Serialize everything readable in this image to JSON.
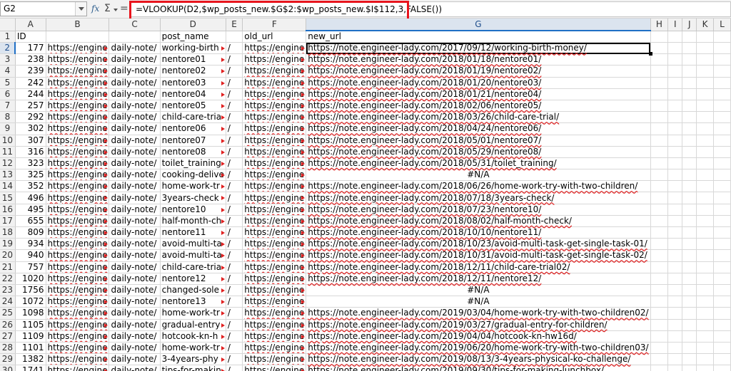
{
  "formula_bar": {
    "cell_ref": "G2",
    "fx_label": "fx",
    "sum_label": "Σ",
    "equals_label": "=",
    "formula": "=VLOOKUP(D2,$wp_posts_new.$G$2:$wp_posts_new.$I$112,3,FALSE())"
  },
  "highlight_color": "#e8141d",
  "columns": [
    "A",
    "B",
    "C",
    "D",
    "E",
    "F",
    "G",
    "H",
    "I",
    "J",
    "K",
    "L"
  ],
  "active_column": "G",
  "active_row": "2",
  "rows": [
    {
      "n": "1",
      "a": "ID",
      "b": "",
      "c": "",
      "d": "post_name",
      "e": "",
      "f": "old_url",
      "g": "new_url"
    },
    {
      "n": "2",
      "a": "177",
      "b": "https://engine",
      "c": "daily-note/",
      "d": "working-birth",
      "e": "/",
      "f": "https://engine",
      "g": "https://note.engineer-lady.com/2017/09/12/working-birth-money/"
    },
    {
      "n": "3",
      "a": "238",
      "b": "https://engine",
      "c": "daily-note/",
      "d": "nentore01",
      "e": "/",
      "f": "https://engine",
      "g": "https://note.engineer-lady.com/2018/01/18/nentore01/"
    },
    {
      "n": "4",
      "a": "239",
      "b": "https://engine",
      "c": "daily-note/",
      "d": "nentore02",
      "e": "/",
      "f": "https://engine",
      "g": "https://note.engineer-lady.com/2018/01/19/nentore02/"
    },
    {
      "n": "5",
      "a": "242",
      "b": "https://engine",
      "c": "daily-note/",
      "d": "nentore03",
      "e": "/",
      "f": "https://engine",
      "g": "https://note.engineer-lady.com/2018/01/20/nentore03/"
    },
    {
      "n": "6",
      "a": "244",
      "b": "https://engine",
      "c": "daily-note/",
      "d": "nentore04",
      "e": "/",
      "f": "https://engine",
      "g": "https://note.engineer-lady.com/2018/01/21/nentore04/"
    },
    {
      "n": "7",
      "a": "257",
      "b": "https://engine",
      "c": "daily-note/",
      "d": "nentore05",
      "e": "/",
      "f": "https://engine",
      "g": "https://note.engineer-lady.com/2018/02/06/nentore05/"
    },
    {
      "n": "8",
      "a": "292",
      "b": "https://engine",
      "c": "daily-note/",
      "d": "child-care-tria",
      "e": "/",
      "f": "https://engine",
      "g": "https://note.engineer-lady.com/2018/03/26/child-care-trial/"
    },
    {
      "n": "9",
      "a": "302",
      "b": "https://engine",
      "c": "daily-note/",
      "d": "nentore06",
      "e": "/",
      "f": "https://engine",
      "g": "https://note.engineer-lady.com/2018/04/24/nentore06/"
    },
    {
      "n": "10",
      "a": "307",
      "b": "https://engine",
      "c": "daily-note/",
      "d": "nentore07",
      "e": "/",
      "f": "https://engine",
      "g": "https://note.engineer-lady.com/2018/05/01/nentore07/"
    },
    {
      "n": "11",
      "a": "316",
      "b": "https://engine",
      "c": "daily-note/",
      "d": "nentore08",
      "e": "/",
      "f": "https://engine",
      "g": "https://note.engineer-lady.com/2018/05/29/nentore08/"
    },
    {
      "n": "12",
      "a": "323",
      "b": "https://engine",
      "c": "daily-note/",
      "d": "toilet_training",
      "e": "/",
      "f": "https://engine",
      "g": "https://note.engineer-lady.com/2018/05/31/toilet_training/"
    },
    {
      "n": "13",
      "a": "325",
      "b": "https://engine",
      "c": "daily-note/",
      "d": "cooking-delive",
      "e": "/",
      "f": "https://engine",
      "g": "#N/A"
    },
    {
      "n": "14",
      "a": "352",
      "b": "https://engine",
      "c": "daily-note/",
      "d": "home-work-tr",
      "e": "/",
      "f": "https://engine",
      "g": "https://note.engineer-lady.com/2018/06/26/home-work-try-with-two-children/"
    },
    {
      "n": "15",
      "a": "496",
      "b": "https://engine",
      "c": "daily-note/",
      "d": "3years-check",
      "e": "/",
      "f": "https://engine",
      "g": "https://note.engineer-lady.com/2018/07/18/3years-check/"
    },
    {
      "n": "16",
      "a": "495",
      "b": "https://engine",
      "c": "daily-note/",
      "d": "nentore10",
      "e": "/",
      "f": "https://engine",
      "g": "https://note.engineer-lady.com/2018/07/23/nentore10/"
    },
    {
      "n": "17",
      "a": "655",
      "b": "https://engine",
      "c": "daily-note/",
      "d": "half-month-ch",
      "e": "/",
      "f": "https://engine",
      "g": "https://note.engineer-lady.com/2018/08/02/half-month-check/"
    },
    {
      "n": "18",
      "a": "809",
      "b": "https://engine",
      "c": "daily-note/",
      "d": "nentore11",
      "e": "/",
      "f": "https://engine",
      "g": "https://note.engineer-lady.com/2018/10/10/nentore11/"
    },
    {
      "n": "19",
      "a": "934",
      "b": "https://engine",
      "c": "daily-note/",
      "d": "avoid-multi-ta",
      "e": "/",
      "f": "https://engine",
      "g": "https://note.engineer-lady.com/2018/10/23/avoid-multi-task-get-single-task-01/"
    },
    {
      "n": "20",
      "a": "940",
      "b": "https://engine",
      "c": "daily-note/",
      "d": "avoid-multi-ta",
      "e": "/",
      "f": "https://engine",
      "g": "https://note.engineer-lady.com/2018/10/31/avoid-multi-task-get-single-task-02/"
    },
    {
      "n": "21",
      "a": "757",
      "b": "https://engine",
      "c": "daily-note/",
      "d": "child-care-tria",
      "e": "/",
      "f": "https://engine",
      "g": "https://note.engineer-lady.com/2018/12/11/child-care-trial02/"
    },
    {
      "n": "22",
      "a": "1020",
      "b": "https://engine",
      "c": "daily-note/",
      "d": "nentore12",
      "e": "/",
      "f": "https://engine",
      "g": "https://note.engineer-lady.com/2018/12/11/nentore12/"
    },
    {
      "n": "23",
      "a": "1756",
      "b": "https://engine",
      "c": "daily-note/",
      "d": "changed-sole",
      "e": "/",
      "f": "https://engine",
      "g": "#N/A"
    },
    {
      "n": "24",
      "a": "1072",
      "b": "https://engine",
      "c": "daily-note/",
      "d": "nentore13",
      "e": "/",
      "f": "https://engine",
      "g": "#N/A"
    },
    {
      "n": "25",
      "a": "1098",
      "b": "https://engine",
      "c": "daily-note/",
      "d": "home-work-tr",
      "e": "/",
      "f": "https://engine",
      "g": "https://note.engineer-lady.com/2019/03/04/home-work-try-with-two-children02/"
    },
    {
      "n": "26",
      "a": "1105",
      "b": "https://engine",
      "c": "daily-note/",
      "d": "gradual-entry",
      "e": "/",
      "f": "https://engine",
      "g": "https://note.engineer-lady.com/2019/03/27/gradual-entry-for-children/"
    },
    {
      "n": "27",
      "a": "1109",
      "b": "https://engine",
      "c": "daily-note/",
      "d": "hotcook-kn-h",
      "e": "/",
      "f": "https://engine",
      "g": "https://note.engineer-lady.com/2019/04/04/hotcook-kn-hw16d/"
    },
    {
      "n": "28",
      "a": "1101",
      "b": "https://engine",
      "c": "daily-note/",
      "d": "home-work-tr",
      "e": "/",
      "f": "https://engine",
      "g": "https://note.engineer-lady.com/2019/06/20/home-work-try-with-two-children03/"
    },
    {
      "n": "29",
      "a": "1382",
      "b": "https://engine",
      "c": "daily-note/",
      "d": "3-4years-phy",
      "e": "/",
      "f": "https://engine",
      "g": "https://note.engineer-lady.com/2019/08/13/3-4years-physical-ko-challenge/"
    },
    {
      "n": "30",
      "a": "1741",
      "b": "https://engine",
      "c": "daily-note/",
      "d": "tips-for-makin",
      "e": "/",
      "f": "https://engine",
      "g": "https://note.engineer-lady.com/2019/09/30/tips-for-making-lunchbox/"
    }
  ]
}
